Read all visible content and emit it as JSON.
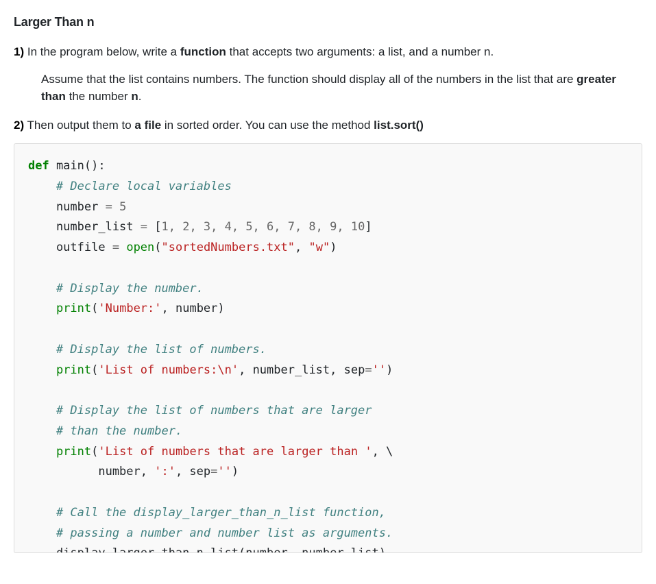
{
  "title": "Larger Than n",
  "instr1": {
    "num": "1)",
    "pre": " In the program below, write a ",
    "bold1": "function",
    "post": " that accepts two arguments: a list, and a number n."
  },
  "indent": {
    "line1": "Assume that the list contains numbers. The function should display all of the numbers in the list that are ",
    "bold": "greater than",
    "post": " the number ",
    "bold2": "n",
    "period": "."
  },
  "instr2": {
    "num": "2)",
    "pre": " Then output them to ",
    "bold1": "a file",
    "mid": " in sorted order. You can use the method ",
    "bold2": "list.sort()"
  },
  "code": {
    "l1_def": "def",
    "l1_main": " main():",
    "l2": "    # Declare local variables",
    "l3_a": "    number ",
    "l3_eq": "=",
    "l3_b": " ",
    "l3_num": "5",
    "l4_a": "    number_list ",
    "l4_eq": "=",
    "l4_b": " [",
    "l4_nums": "1, 2, 3, 4, 5, 6, 7, 8, 9, 10",
    "l4_c": "]",
    "l5_a": "    outfile ",
    "l5_eq": "=",
    "l5_b": " ",
    "l5_open": "open",
    "l5_c": "(",
    "l5_s1": "\"sortedNumbers.txt\"",
    "l5_d": ", ",
    "l5_s2": "\"w\"",
    "l5_e": ")",
    "l7": "    # Display the number.",
    "l8_a": "    ",
    "l8_print": "print",
    "l8_b": "(",
    "l8_s": "'Number:'",
    "l8_c": ", number)",
    "l10": "    # Display the list of numbers.",
    "l11_a": "    ",
    "l11_print": "print",
    "l11_b": "(",
    "l11_s1": "'List of numbers:\\n'",
    "l11_c": ", number_list, sep",
    "l11_eq": "=",
    "l11_s2": "''",
    "l11_d": ")",
    "l13": "    # Display the list of numbers that are larger",
    "l14": "    # than the number.",
    "l15_a": "    ",
    "l15_print": "print",
    "l15_b": "(",
    "l15_s1": "'List of numbers that are larger than '",
    "l15_c": ", \\",
    "l16_a": "          number, ",
    "l16_s": "':'",
    "l16_b": ", sep",
    "l16_eq": "=",
    "l16_s2": "''",
    "l16_c": ")",
    "l18": "    # Call the display_larger_than_n_list function,",
    "l19": "    # passing a number and number list as arguments.",
    "l20": "    display_larger_than_n_list(number, number_list)"
  }
}
